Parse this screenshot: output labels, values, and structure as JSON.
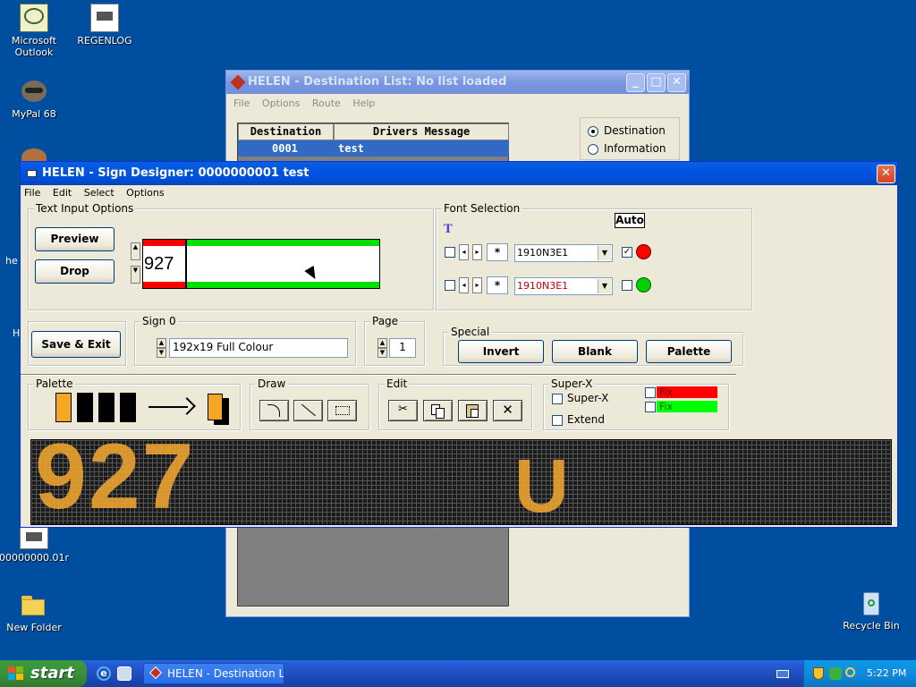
{
  "desktop": {
    "icons": [
      {
        "label": "Microsoft Outlook"
      },
      {
        "label": "REGENLOG"
      },
      {
        "label": "MyPal 68"
      },
      {
        "label": "00000000.01r"
      },
      {
        "label": "New Folder"
      },
      {
        "label": "Recycle Bin"
      }
    ],
    "partial_labels": [
      "he",
      "H"
    ]
  },
  "dest_window": {
    "title": "HELEN - Destination List: No list loaded",
    "menu": [
      "File",
      "Options",
      "Route",
      "Help"
    ],
    "columns": [
      "Destination",
      "Drivers Message"
    ],
    "rows": [
      {
        "destination": "0001",
        "message": "test"
      }
    ],
    "radios": [
      {
        "label": "Destination",
        "selected": true
      },
      {
        "label": "Information",
        "selected": false
      }
    ]
  },
  "designer": {
    "title": "HELEN - Sign Designer: 0000000001 test",
    "menu": [
      "File",
      "Edit",
      "Select",
      "Options"
    ],
    "text_input": {
      "group_label": "Text Input Options",
      "preview_label": "Preview",
      "drop_label": "Drop",
      "value": "927"
    },
    "font_selection": {
      "group_label": "Font Selection",
      "auto_label": "Auto",
      "rows": [
        {
          "size": "*",
          "font": "1910N3E1",
          "font_color": "#000000",
          "auto_checked": true,
          "dot_color": "#ff0000"
        },
        {
          "size": "*",
          "font": "1910N3E1",
          "font_color": "#c00000",
          "auto_checked": false,
          "dot_color": "#00d000"
        }
      ]
    },
    "save_exit_label": "Save & Exit",
    "sign": {
      "group_label": "Sign 0",
      "value": "192x19 Full Colour"
    },
    "page": {
      "group_label": "Page",
      "value": "1"
    },
    "special": {
      "group_label": "Special",
      "invert_label": "Invert",
      "blank_label": "Blank",
      "palette_label": "Palette"
    },
    "palette": {
      "group_label": "Palette",
      "colors": [
        "#f5a623",
        "#000000",
        "#000000",
        "#000000"
      ],
      "current": "#f5a623"
    },
    "draw": {
      "group_label": "Draw"
    },
    "edit": {
      "group_label": "Edit"
    },
    "superx": {
      "group_label": "Super-X",
      "superx_label": "Super-X",
      "extend_label": "Extend",
      "fix_labels": [
        "Fix",
        "Fix"
      ],
      "fix_colors": [
        "#ff0000",
        "#00ff00"
      ]
    },
    "display": {
      "text_left": "927",
      "text_right": "U",
      "led_color": "#f0a030"
    }
  },
  "taskbar": {
    "start_label": "start",
    "task_label": "HELEN - Destination L...",
    "clock": "5:22 PM"
  }
}
